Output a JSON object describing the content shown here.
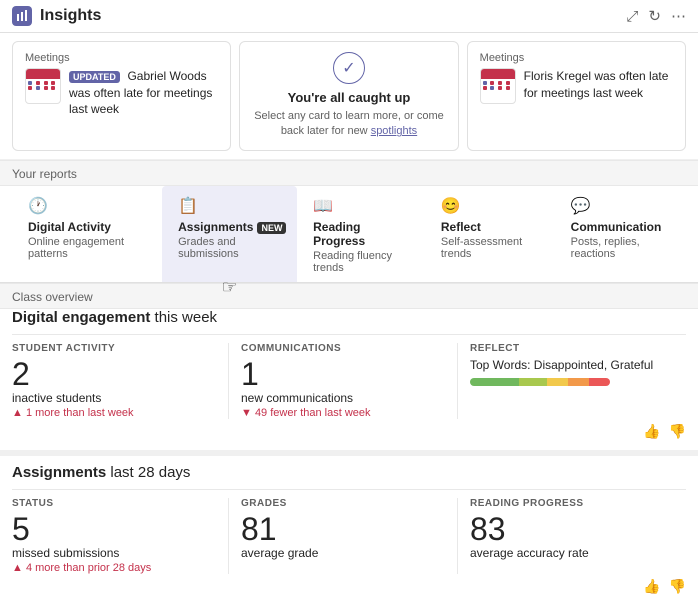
{
  "header": {
    "title": "Insights",
    "expand_icon": "⤢",
    "refresh_icon": "↻",
    "more_icon": "⋯"
  },
  "spotlight": {
    "label": "Meetings",
    "cards": [
      {
        "id": "card-1",
        "section": "Meetings",
        "badge": "UPDATED",
        "description": "Gabriel Woods was often late for meetings last week"
      },
      {
        "id": "card-center",
        "title": "You're all caught up",
        "description": "Select any card to learn more, or come back later for new spotlights",
        "link_text": "spotlights"
      },
      {
        "id": "card-3",
        "section": "Meetings",
        "description": "Floris Kregel was often late for meetings last week"
      }
    ]
  },
  "reports": {
    "label": "Your reports",
    "tabs": [
      {
        "id": "digital-activity",
        "icon": "🕐",
        "name": "Digital Activity",
        "sub": "Online engagement patterns",
        "active": false,
        "new": false
      },
      {
        "id": "assignments",
        "icon": "📋",
        "name": "Assignments",
        "sub": "Grades and submissions",
        "active": true,
        "new": true
      },
      {
        "id": "reading-progress",
        "icon": "📖",
        "name": "Reading Progress",
        "sub": "Reading fluency trends",
        "active": false,
        "new": false
      },
      {
        "id": "reflect",
        "icon": "😊",
        "name": "Reflect",
        "sub": "Self-assessment trends",
        "active": false,
        "new": false
      },
      {
        "id": "communication",
        "icon": "💬",
        "name": "Communication",
        "sub": "Posts, replies, reactions",
        "active": false,
        "new": false
      }
    ]
  },
  "class_overview": {
    "label": "Class overview"
  },
  "digital_engagement": {
    "title": "Digital engagement",
    "period": "this week",
    "student_activity": {
      "label": "STUDENT ACTIVITY",
      "number": "2",
      "desc": "inactive students",
      "change": "▲ 1 more than last week",
      "change_direction": "up"
    },
    "communications": {
      "label": "COMMUNICATIONS",
      "number": "1",
      "desc": "new communications",
      "change": "▼ 49 fewer than last week",
      "change_direction": "down"
    },
    "reflect": {
      "label": "REFLECT",
      "top_words_label": "Top Words: Disappointed, Grateful",
      "bar_segments": [
        {
          "color": "#70b85e",
          "width": 35
        },
        {
          "color": "#a8c84e",
          "width": 20
        },
        {
          "color": "#f2c94c",
          "width": 15
        },
        {
          "color": "#f2994a",
          "width": 15
        },
        {
          "color": "#eb5757",
          "width": 15
        }
      ]
    }
  },
  "assignments": {
    "title": "Assignments",
    "period": "last 28 days",
    "status": {
      "label": "STATUS",
      "number": "5",
      "desc": "missed submissions",
      "change": "▲ 4 more than prior 28 days",
      "change_direction": "up"
    },
    "grades": {
      "label": "GRADES",
      "number": "81",
      "desc": "average grade"
    },
    "reading_progress": {
      "label": "READING PROGRESS",
      "number": "83",
      "desc": "average accuracy rate"
    }
  },
  "feedback": {
    "thumbs_up": "👍",
    "thumbs_down": "👎"
  }
}
